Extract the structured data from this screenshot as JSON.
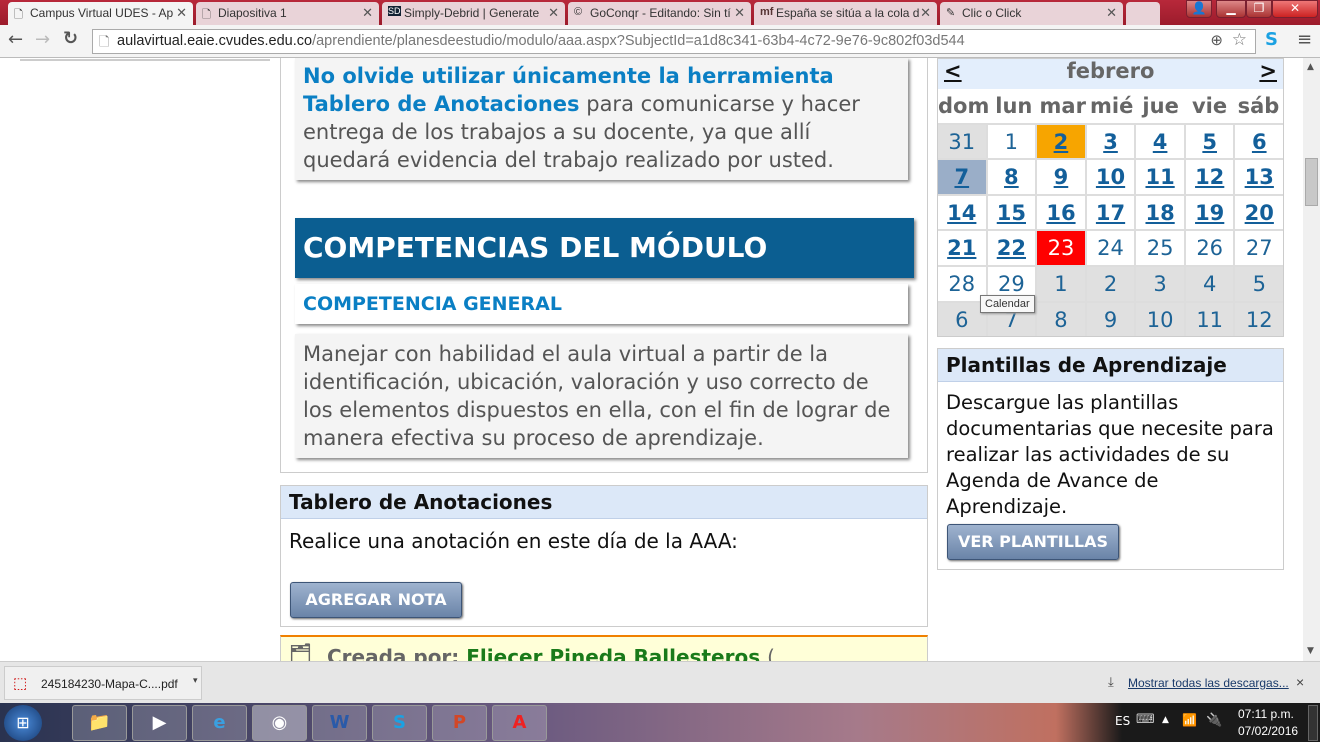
{
  "browser": {
    "tabs": [
      {
        "title": "Campus Virtual UDES - Ap",
        "icon": "page-icon",
        "active": true
      },
      {
        "title": "Diapositiva 1",
        "icon": "page-icon"
      },
      {
        "title": "Simply-Debrid | Generate",
        "icon": "SD"
      },
      {
        "title": "GoConqr - Editando: Sin tí",
        "icon": "goconqr-icon"
      },
      {
        "title": "España se sitúa a la cola d",
        "icon": "mf"
      },
      {
        "title": "Clic o Click",
        "icon": "pencil-icon"
      }
    ],
    "url_host": "aulavirtual.eaie.cvudes.edu.co",
    "url_path": "/aprendiente/planesdeestudio/modulo/aaa.aspx?SubjectId=a1d8c341-63b4-4c72-9e76-9c802f03d544"
  },
  "notice": {
    "bold1": "No olvide utilizar únicamente la herramienta",
    "bold2": "Tablero de Anotaciones",
    "rest": " para comunicarse y hacer entrega de los trabajos a su docente, ya que allí quedará evidencia del trabajo realizado por usted."
  },
  "competencias": {
    "title": "COMPETENCIAS DEL MÓDULO",
    "subtitle": "COMPETENCIA GENERAL",
    "text": "Manejar con habilidad el aula virtual a partir de la identificación, ubicación, valoración y uso correcto de los elementos dispuestos en ella, con el fin de lograr de manera efectiva su proceso de aprendizaje."
  },
  "tablero": {
    "title": "Tablero de Anotaciones",
    "text": "Realice una anotación en este día de la AAA:",
    "button": "AGREGAR NOTA"
  },
  "note_entry": {
    "created_label": "Creada por:",
    "author": "Eliecer Pineda Ballesteros",
    "paren": "("
  },
  "calendar": {
    "month": "febrero",
    "prev": "<",
    "next": ">",
    "days_header": [
      "dom",
      "lun",
      "mar",
      "mié",
      "jue",
      "vie",
      "sáb"
    ],
    "weeks": [
      [
        [
          "31",
          "other"
        ],
        [
          "1",
          ""
        ],
        [
          "2",
          "link sel"
        ],
        [
          "3",
          "link"
        ],
        [
          "4",
          "link"
        ],
        [
          "5",
          "link"
        ],
        [
          "6",
          "link"
        ]
      ],
      [
        [
          "7",
          "link wk"
        ],
        [
          "8",
          "link"
        ],
        [
          "9",
          "link"
        ],
        [
          "10",
          "link"
        ],
        [
          "11",
          "link"
        ],
        [
          "12",
          "link"
        ],
        [
          "13",
          "link"
        ]
      ],
      [
        [
          "14",
          "link"
        ],
        [
          "15",
          "link"
        ],
        [
          "16",
          "link"
        ],
        [
          "17",
          "link"
        ],
        [
          "18",
          "link"
        ],
        [
          "19",
          "link"
        ],
        [
          "20",
          "link"
        ]
      ],
      [
        [
          "21",
          "link"
        ],
        [
          "22",
          "link"
        ],
        [
          "23",
          "today"
        ],
        [
          "24",
          ""
        ],
        [
          "25",
          ""
        ],
        [
          "26",
          ""
        ],
        [
          "27",
          ""
        ]
      ],
      [
        [
          "28",
          ""
        ],
        [
          "29",
          ""
        ],
        [
          "1",
          "other"
        ],
        [
          "2",
          "other"
        ],
        [
          "3",
          "other"
        ],
        [
          "4",
          "other"
        ],
        [
          "5",
          "other"
        ]
      ],
      [
        [
          "6",
          "other"
        ],
        [
          "7",
          "other"
        ],
        [
          "8",
          "other"
        ],
        [
          "9",
          "other"
        ],
        [
          "10",
          "other"
        ],
        [
          "11",
          "other"
        ],
        [
          "12",
          "other"
        ]
      ]
    ],
    "tooltip": "Calendar"
  },
  "plantillas": {
    "title": "Plantillas de Aprendizaje",
    "text": "Descargue las plantillas documentarias que necesite para realizar las actividades de su Agenda de Avance de Aprendizaje.",
    "button": "VER PLANTILLAS"
  },
  "downloads": {
    "file": "245184230-Mapa-C....pdf",
    "show_all": "Mostrar todas las descargas...",
    "close": "×"
  },
  "taskbar": {
    "lang": "ES",
    "time": "07:11 p.m.",
    "date": "07/02/2016"
  }
}
